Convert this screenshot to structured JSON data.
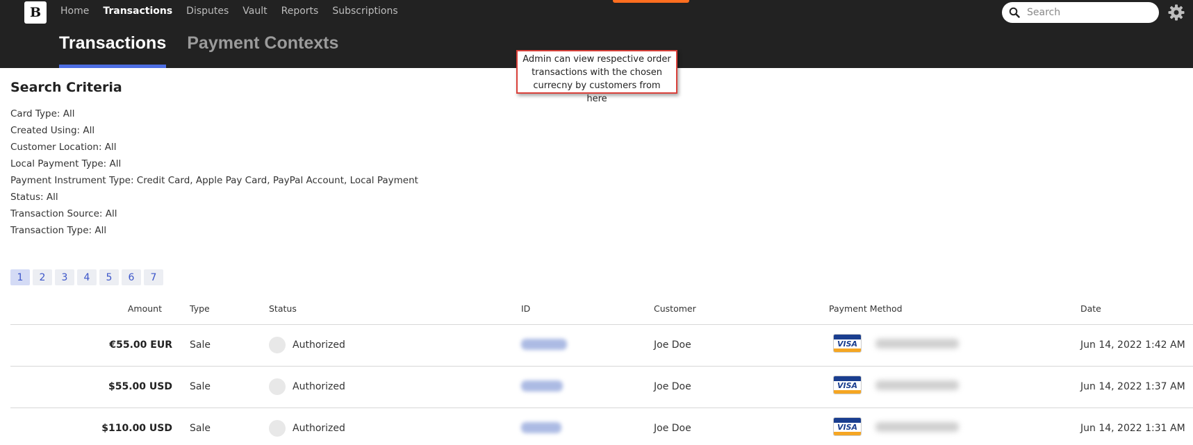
{
  "nav": {
    "logo": "B",
    "items": [
      {
        "label": "Home",
        "active": false
      },
      {
        "label": "Transactions",
        "active": true
      },
      {
        "label": "Disputes",
        "active": false
      },
      {
        "label": "Vault",
        "active": false
      },
      {
        "label": "Reports",
        "active": false
      },
      {
        "label": "Subscriptions",
        "active": false
      }
    ],
    "search_placeholder": "Search",
    "accent_color": "#ff6e1f"
  },
  "subtabs": [
    {
      "label": "Transactions",
      "active": true
    },
    {
      "label": "Payment Contexts",
      "active": false
    }
  ],
  "callout": {
    "text": "Admin can view respective order transactions with the chosen currecny by customers from here",
    "border_color": "#d9403a"
  },
  "search_criteria": {
    "title": "Search Criteria",
    "items": [
      "Card Type: All",
      "Created Using: All",
      "Customer Location: All",
      "Local Payment Type: All",
      "Payment Instrument Type: Credit Card, Apple Pay Card, PayPal Account, Local Payment",
      "Status: All",
      "Transaction Source: All",
      "Transaction Type: All"
    ]
  },
  "pagination": {
    "pages": [
      "1",
      "2",
      "3",
      "4",
      "5",
      "6",
      "7"
    ],
    "current": "1"
  },
  "table": {
    "columns": {
      "amount": "Amount",
      "type": "Type",
      "status": "Status",
      "id": "ID",
      "customer": "Customer",
      "payment_method": "Payment Method",
      "date": "Date"
    },
    "rows": [
      {
        "amount": "€55.00 EUR",
        "type": "Sale",
        "status": "Authorized",
        "customer": "Joe Doe",
        "card_brand": "VISA",
        "date": "Jun 14, 2022 1:42 AM"
      },
      {
        "amount": "$55.00 USD",
        "type": "Sale",
        "status": "Authorized",
        "customer": "Joe Doe",
        "card_brand": "VISA",
        "date": "Jun 14, 2022 1:37 AM"
      },
      {
        "amount": "$110.00 USD",
        "type": "Sale",
        "status": "Authorized",
        "customer": "Joe Doe",
        "card_brand": "VISA",
        "date": "Jun 14, 2022 1:31 AM"
      }
    ]
  }
}
